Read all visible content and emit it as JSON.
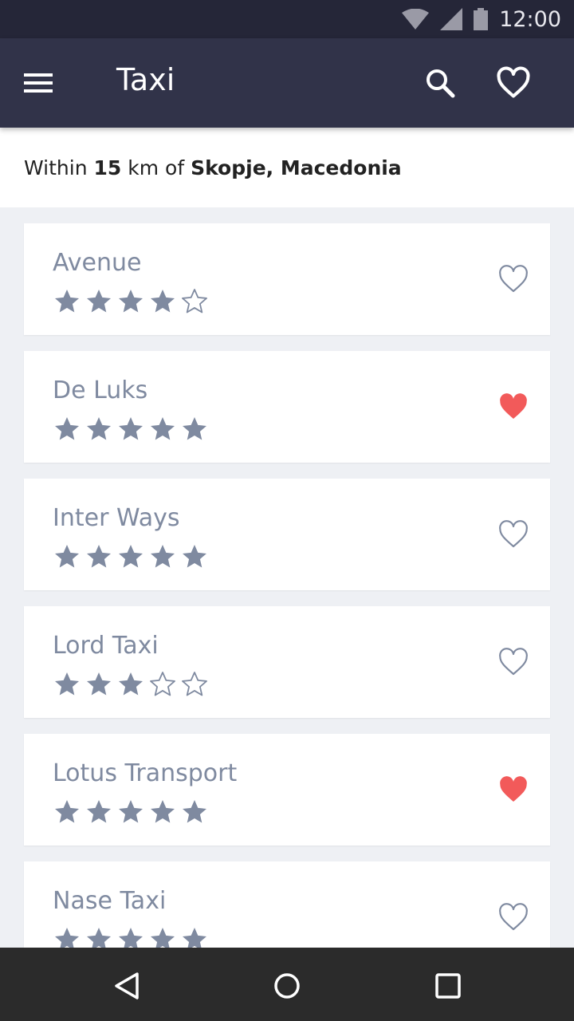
{
  "status_bar": {
    "time": "12:00",
    "icons": [
      "wifi-icon",
      "signal-icon",
      "battery-icon"
    ]
  },
  "app_bar": {
    "title": "Taxi",
    "icons": [
      "menu-icon",
      "search-icon",
      "heart-outline-icon"
    ]
  },
  "filter": {
    "prefix": "Within",
    "distance": "15",
    "unit_of": "km of",
    "location": "Skopje, Macedonia"
  },
  "taxis": [
    {
      "name": "Avenue",
      "rating": 4,
      "favorite": false
    },
    {
      "name": "De Luks",
      "rating": 5,
      "favorite": true
    },
    {
      "name": "Inter Ways",
      "rating": 5,
      "favorite": false
    },
    {
      "name": "Lord Taxi",
      "rating": 3,
      "favorite": false
    },
    {
      "name": "Lotus Transport",
      "rating": 5,
      "favorite": true
    },
    {
      "name": "Nase Taxi",
      "rating": 5,
      "favorite": false
    }
  ],
  "nav_bar": {
    "icons": [
      "back-icon",
      "home-icon",
      "recents-icon"
    ]
  },
  "colors": {
    "app_bar": "#313349",
    "status_bar": "#252638",
    "star_filled": "#7f8aa0",
    "heart_favorite": "#f25a5a",
    "heart_outline": "#7f8aa0"
  }
}
